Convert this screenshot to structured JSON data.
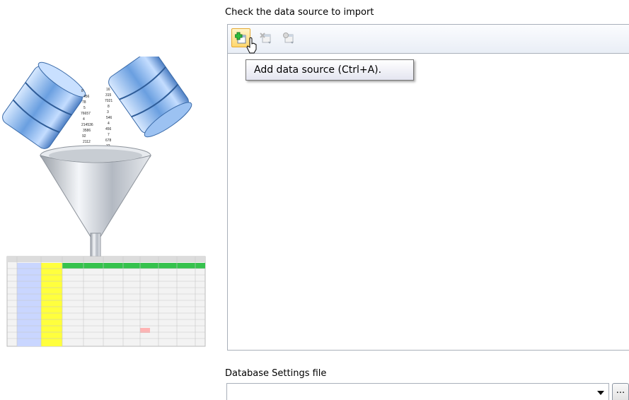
{
  "import": {
    "label": "Check the data source to import",
    "toolbar": {
      "add_title": "Add data source",
      "remove_title": "Remove data source",
      "edit_title": "Edit data source"
    },
    "tooltip": "Add data source (Ctrl+A)."
  },
  "database_settings": {
    "label": "Database Settings file",
    "value": "",
    "browse_label": "..."
  },
  "colors": {
    "cylinder": "#8fb9e8",
    "funnel": "#c9ced6",
    "header_green": "#35c24d",
    "highlight_yellow": "#ffff3d",
    "id_column": "#c9d6ff"
  }
}
